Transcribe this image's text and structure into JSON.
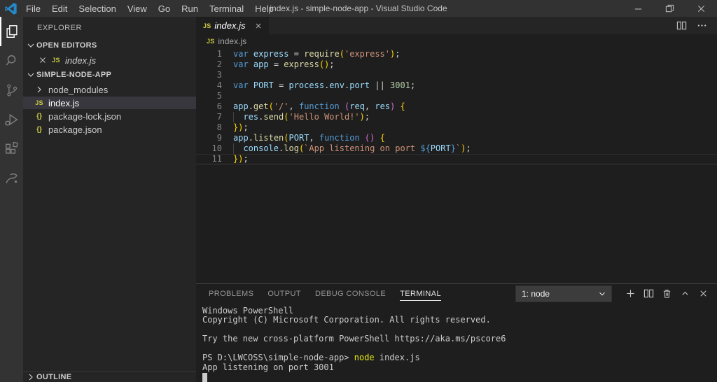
{
  "titlebar": {
    "title": "index.js - simple-node-app - Visual Studio Code",
    "menu": [
      "File",
      "Edit",
      "Selection",
      "View",
      "Go",
      "Run",
      "Terminal",
      "Help"
    ],
    "window_controls": [
      "minimize",
      "restore",
      "close"
    ]
  },
  "activity_bar": {
    "items": [
      {
        "icon": "explorer",
        "active": true
      },
      {
        "icon": "search",
        "active": false
      },
      {
        "icon": "source-control",
        "active": false
      },
      {
        "icon": "run-debug",
        "active": false
      },
      {
        "icon": "extensions",
        "active": false
      },
      {
        "icon": "custom-extension",
        "active": false
      }
    ]
  },
  "sidebar": {
    "title": "EXPLORER",
    "open_editors": {
      "label": "OPEN EDITORS",
      "items": [
        {
          "icon": "js",
          "label": "index.js",
          "italic": true,
          "closable": true
        }
      ]
    },
    "project": {
      "label": "SIMPLE-NODE-APP",
      "items": [
        {
          "icon": "folder",
          "label": "node_modules",
          "selected": false
        },
        {
          "icon": "js",
          "label": "index.js",
          "selected": true
        },
        {
          "icon": "json",
          "label": "package-lock.json",
          "selected": false
        },
        {
          "icon": "json",
          "label": "package.json",
          "selected": false
        }
      ]
    },
    "outline_label": "OUTLINE"
  },
  "editor": {
    "tab": {
      "icon": "js",
      "label": "index.js"
    },
    "breadcrumb": {
      "icon": "js",
      "label": "index.js"
    },
    "lines": [
      {
        "n": 1,
        "segs": [
          [
            "kw",
            "var "
          ],
          [
            "id",
            "express "
          ],
          [
            "pun",
            "= "
          ],
          [
            "fn",
            "require"
          ],
          [
            "b1",
            "("
          ],
          [
            "str",
            "'express'"
          ],
          [
            "b1",
            ")"
          ],
          [
            "pun",
            ";"
          ]
        ]
      },
      {
        "n": 2,
        "segs": [
          [
            "kw",
            "var "
          ],
          [
            "id",
            "app "
          ],
          [
            "pun",
            "= "
          ],
          [
            "fn",
            "express"
          ],
          [
            "b1",
            "()"
          ],
          [
            "pun",
            ";"
          ]
        ]
      },
      {
        "n": 3,
        "segs": []
      },
      {
        "n": 4,
        "segs": [
          [
            "kw",
            "var "
          ],
          [
            "id",
            "PORT "
          ],
          [
            "pun",
            "= "
          ],
          [
            "id",
            "process"
          ],
          [
            "pun",
            "."
          ],
          [
            "id",
            "env"
          ],
          [
            "pun",
            "."
          ],
          [
            "id",
            "port"
          ],
          [
            "pun",
            " || "
          ],
          [
            "num",
            "3001"
          ],
          [
            "pun",
            ";"
          ]
        ]
      },
      {
        "n": 5,
        "segs": []
      },
      {
        "n": 6,
        "segs": [
          [
            "id",
            "app"
          ],
          [
            "pun",
            "."
          ],
          [
            "fn",
            "get"
          ],
          [
            "b1",
            "("
          ],
          [
            "str",
            "'/'"
          ],
          [
            "pun",
            ", "
          ],
          [
            "kw",
            "function "
          ],
          [
            "b2",
            "("
          ],
          [
            "id",
            "req"
          ],
          [
            "pun",
            ", "
          ],
          [
            "id",
            "res"
          ],
          [
            "b2",
            ")"
          ],
          [
            "pun",
            " "
          ],
          [
            "b1",
            "{"
          ]
        ]
      },
      {
        "n": 7,
        "guide": true,
        "segs": [
          [
            "id",
            "res"
          ],
          [
            "pun",
            "."
          ],
          [
            "fn",
            "send"
          ],
          [
            "b1",
            "("
          ],
          [
            "str",
            "'Hello World!'"
          ],
          [
            "b1",
            ")"
          ],
          [
            "pun",
            ";"
          ]
        ]
      },
      {
        "n": 8,
        "segs": [
          [
            "b1",
            "})"
          ],
          [
            "pun",
            ";"
          ]
        ]
      },
      {
        "n": 9,
        "segs": [
          [
            "id",
            "app"
          ],
          [
            "pun",
            "."
          ],
          [
            "fn",
            "listen"
          ],
          [
            "b1",
            "("
          ],
          [
            "id",
            "PORT"
          ],
          [
            "pun",
            ", "
          ],
          [
            "kw",
            "function "
          ],
          [
            "b2",
            "()"
          ],
          [
            "pun",
            " "
          ],
          [
            "b1",
            "{"
          ]
        ]
      },
      {
        "n": 10,
        "guide": true,
        "segs": [
          [
            "id",
            "console"
          ],
          [
            "pun",
            "."
          ],
          [
            "fn",
            "log"
          ],
          [
            "b1",
            "("
          ],
          [
            "str",
            "`App listening on port "
          ],
          [
            "tpl",
            "${"
          ],
          [
            "id",
            "PORT"
          ],
          [
            "tpl",
            "}"
          ],
          [
            "str",
            "`"
          ],
          [
            "b1",
            ")"
          ],
          [
            "pun",
            ";"
          ]
        ]
      },
      {
        "n": 11,
        "current": true,
        "segs": [
          [
            "b1",
            "})"
          ],
          [
            "pun",
            ";"
          ]
        ]
      }
    ]
  },
  "panel": {
    "tabs": [
      {
        "label": "PROBLEMS",
        "active": false
      },
      {
        "label": "OUTPUT",
        "active": false
      },
      {
        "label": "DEBUG CONSOLE",
        "active": false
      },
      {
        "label": "TERMINAL",
        "active": true
      }
    ],
    "terminal_select": "1: node",
    "actions": [
      "new-terminal",
      "split-terminal",
      "kill-terminal",
      "maximize-panel",
      "close-panel"
    ],
    "terminal_lines": [
      [
        [
          "t",
          "Windows PowerShell"
        ]
      ],
      [
        [
          "t",
          "Copyright (C) Microsoft Corporation. All rights reserved."
        ]
      ],
      [],
      [
        [
          "t",
          "Try the new cross-platform PowerShell https://aka.ms/pscore6"
        ]
      ],
      [],
      [
        [
          "t",
          "PS D:\\LWCOSS\\simple-node-app> "
        ],
        [
          "cmd",
          "node"
        ],
        [
          "t",
          " index.js"
        ]
      ],
      [
        [
          "t",
          "App listening on port 3001"
        ]
      ]
    ],
    "cursor_visible": true
  },
  "colors": {
    "kw": "#569CD6",
    "id": "#9CDCFE",
    "fn": "#DCDCAA",
    "str": "#CE9178",
    "num": "#B5CEA8",
    "pun": "#D4D4D4",
    "b1": "#FFD700",
    "b2": "#DA70D6",
    "tpl": "#569CD6",
    "t": "#CCCCCC",
    "cmd": "#E5E510",
    "file-yellow": "#CBCB41",
    "logo-blue": "#2489CA",
    "editor-bg": "#1E1E1E",
    "sidebar-bg": "#252526",
    "titlebar-bg": "#323233",
    "activitybar-bg": "#333333",
    "selected-row": "#37373D"
  }
}
